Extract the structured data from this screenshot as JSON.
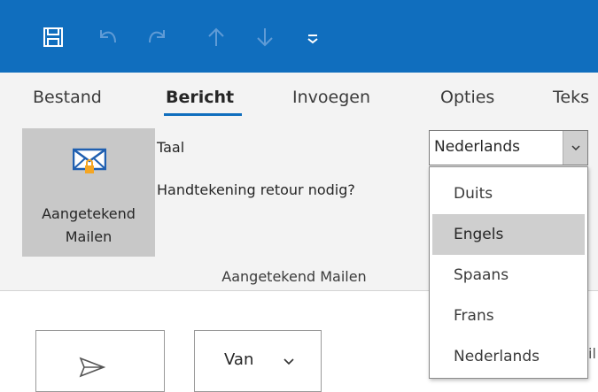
{
  "qat": {
    "items": [
      "save-icon",
      "undo-icon",
      "redo-icon",
      "arrow-up-icon",
      "arrow-down-icon",
      "customize-icon"
    ]
  },
  "tabs": [
    {
      "label": "Bestand",
      "active": false
    },
    {
      "label": "Bericht",
      "active": true
    },
    {
      "label": "Invoegen",
      "active": false
    },
    {
      "label": "Opties",
      "active": false
    },
    {
      "label": "Teks",
      "active": false
    }
  ],
  "ribbon": {
    "button_line1": "Aangetekend",
    "button_line2": "Mailen",
    "language_label": "Taal",
    "return_receipt_label": "Handtekening retour nodig?",
    "group_label": "Aangetekend Mailen",
    "group_sep_partial": "&"
  },
  "language": {
    "selected": "Nederlands",
    "options": [
      "Duits",
      "Engels",
      "Spaans",
      "Frans",
      "Nederlands"
    ],
    "highlighted": "Engels"
  },
  "compose": {
    "from_label": "Van",
    "partial_right_1": "i",
    "partial_right_2": "il"
  },
  "colors": {
    "title_bar": "#106ebe",
    "ribbon_bg": "#f3f3f3",
    "highlight": "#cfcfcf",
    "accent": "#106ebe"
  }
}
